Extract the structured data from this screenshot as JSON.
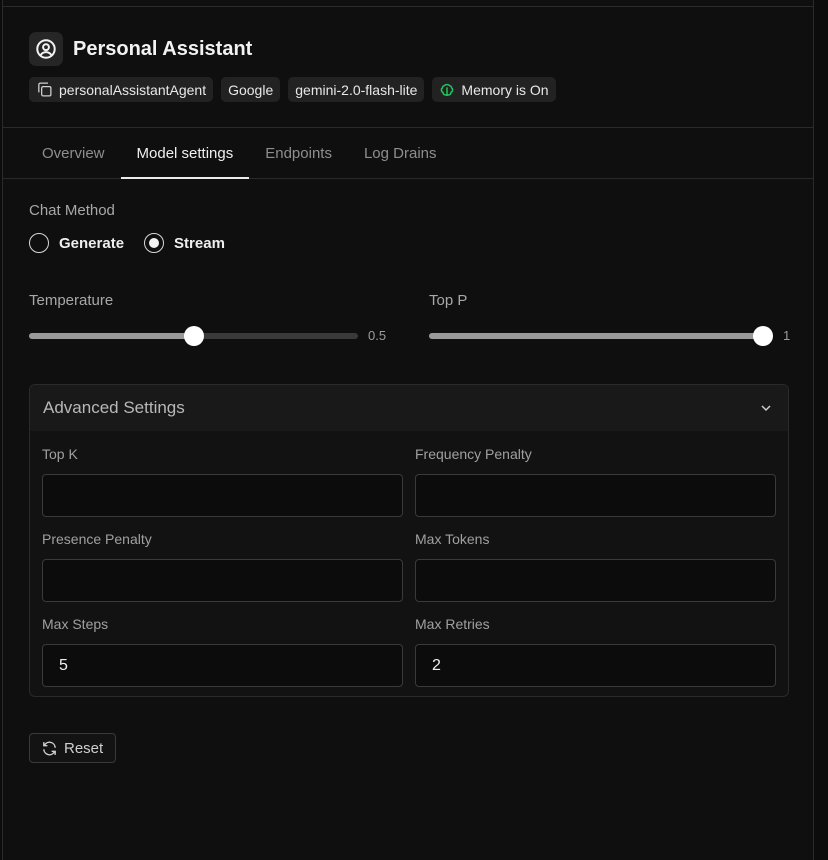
{
  "agent": {
    "title": "Personal Assistant",
    "icon": "user-circle-icon",
    "badges": {
      "id": "personalAssistantAgent",
      "provider": "Google",
      "model": "gemini-2.0-flash-lite",
      "memory": "Memory is On"
    },
    "memory_icon_color": "#22c55e"
  },
  "tabs": {
    "overview": "Overview",
    "model_settings": "Model settings",
    "endpoints": "Endpoints",
    "log_drains": "Log Drains",
    "active": "Model settings"
  },
  "chat_method": {
    "label": "Chat Method",
    "options": {
      "generate": "Generate",
      "stream": "Stream"
    },
    "selected": "Stream"
  },
  "temperature": {
    "label": "Temperature",
    "value": "0.5",
    "fraction": 0.5
  },
  "top_p": {
    "label": "Top P",
    "value": "1",
    "fraction": 1.0
  },
  "advanced": {
    "title": "Advanced Settings",
    "top_k": {
      "label": "Top K",
      "value": ""
    },
    "frequency_penalty": {
      "label": "Frequency Penalty",
      "value": ""
    },
    "presence_penalty": {
      "label": "Presence Penalty",
      "value": ""
    },
    "max_tokens": {
      "label": "Max Tokens",
      "value": ""
    },
    "max_steps": {
      "label": "Max Steps",
      "value": "5"
    },
    "max_retries": {
      "label": "Max Retries",
      "value": "2"
    }
  },
  "reset_label": "Reset"
}
